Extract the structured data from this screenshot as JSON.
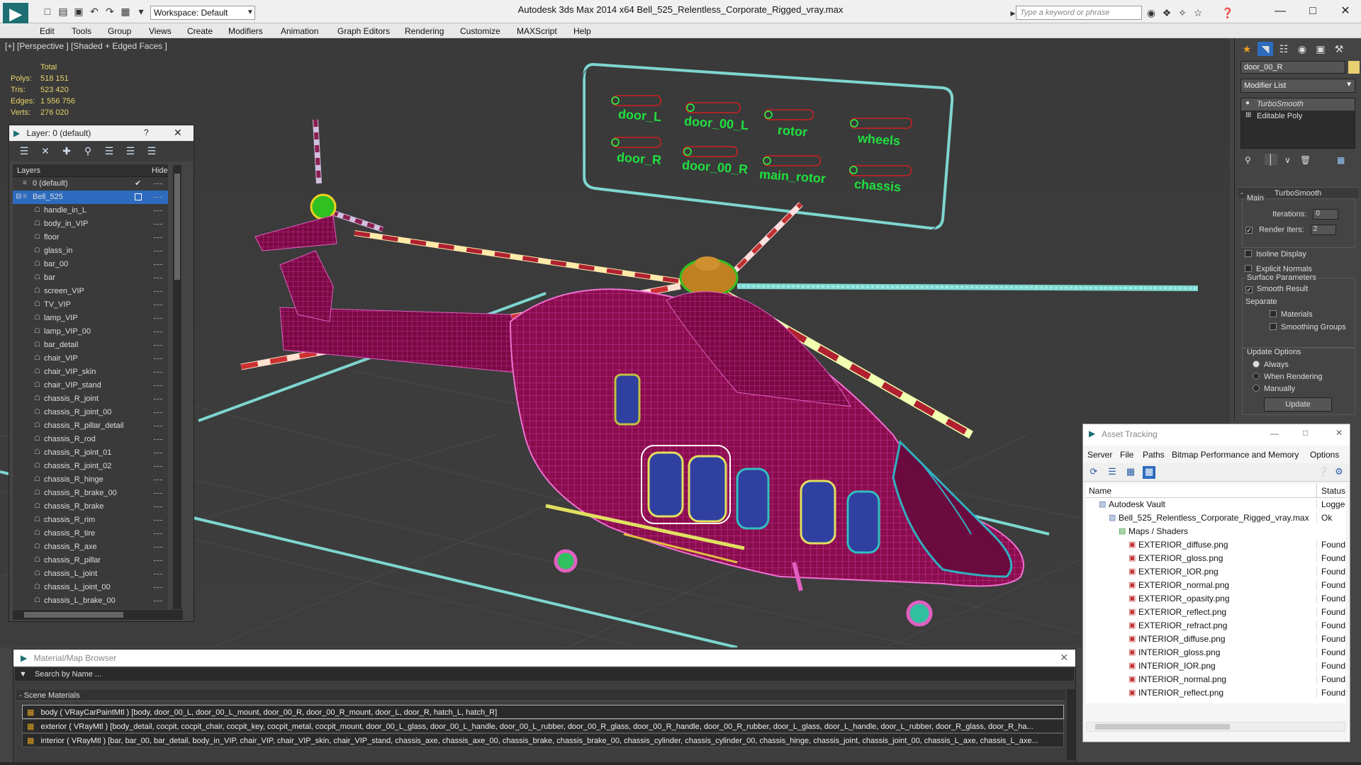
{
  "app": {
    "title": "Autodesk 3ds Max  2014 x64     Bell_525_Relentless_Corporate_Rigged_vray.max",
    "workspace": "Workspace: Default",
    "search_placeholder": "Type a keyword or phrase"
  },
  "menu": [
    "Edit",
    "Tools",
    "Group",
    "Views",
    "Create",
    "Modifiers",
    "Animation",
    "Graph Editors",
    "Rendering",
    "Customize",
    "MAXScript",
    "Help"
  ],
  "viewport": {
    "label": "[+] [Perspective ] [Shaded + Edged Faces ]",
    "stats_header": "Total",
    "stats": [
      {
        "k": "Polys:",
        "v": "518 151"
      },
      {
        "k": "Tris:",
        "v": "523 420"
      },
      {
        "k": "Edges:",
        "v": "1 556 756"
      },
      {
        "k": "Verts:",
        "v": "276 020"
      }
    ],
    "rig_labels": [
      "door_L",
      "door_00_L",
      "rotor",
      "wheels",
      "door_R",
      "door_00_R",
      "main_rotor",
      "chassis"
    ]
  },
  "layer_panel": {
    "title": "Layer: 0 (default)",
    "col_layers": "Layers",
    "col_hide": "Hide",
    "rows": [
      "0 (default)",
      "Bell_525",
      "handle_in_L",
      "body_in_VIP",
      "floor",
      "glass_in",
      "bar_00",
      "bar",
      "screen_VIP",
      "TV_VIP",
      "lamp_VIP",
      "lamp_VIP_00",
      "bar_detail",
      "chair_VIP",
      "chair_VIP_skin",
      "chair_VIP_stand",
      "chassis_R_joint",
      "chassis_R_joint_00",
      "chassis_R_pillar_detail",
      "chassis_R_rod",
      "chassis_R_joint_01",
      "chassis_R_joint_02",
      "chassis_R_hinge",
      "chassis_R_brake_00",
      "chassis_R_brake",
      "chassis_R_rim",
      "chassis_R_tire",
      "chassis_R_axe",
      "chassis_R_pillar",
      "chassis_L_joint",
      "chassis_L_joint_00",
      "chassis_L_brake_00"
    ]
  },
  "command_panel": {
    "object_name": "door_00_R",
    "modifier_list": "Modifier List",
    "stack": [
      "TurboSmooth",
      "Editable Poly"
    ],
    "rollout_title": "TurboSmooth",
    "main": "Main",
    "iterations_label": "Iterations:",
    "iterations_value": "0",
    "render_iters_label": "Render Iters:",
    "render_iters_value": "2",
    "isoline": "Isoline Display",
    "explicit": "Explicit Normals",
    "surface_params": "Surface Parameters",
    "smooth_result": "Smooth Result",
    "separate": "Separate",
    "materials": "Materials",
    "smoothing_groups": "Smoothing Groups",
    "update_options": "Update Options",
    "always": "Always",
    "when_rendering": "When Rendering",
    "manually": "Manually",
    "update_button": "Update"
  },
  "asset_tracking": {
    "title": "Asset Tracking",
    "menu": [
      "Server",
      "File",
      "Paths",
      "Bitmap Performance and Memory",
      "Options"
    ],
    "col_name": "Name",
    "col_status": "Status",
    "rows": [
      {
        "name": "Autodesk Vault",
        "status": "Logged O",
        "indent": 1
      },
      {
        "name": "Bell_525_Relentless_Corporate_Rigged_vray.max",
        "status": "Ok",
        "indent": 2
      },
      {
        "name": "Maps / Shaders",
        "status": "",
        "indent": 3
      },
      {
        "name": "EXTERIOR_diffuse.png",
        "status": "Found",
        "indent": 4
      },
      {
        "name": "EXTERIOR_gloss.png",
        "status": "Found",
        "indent": 4
      },
      {
        "name": "EXTERIOR_IOR.png",
        "status": "Found",
        "indent": 4
      },
      {
        "name": "EXTERIOR_normal.png",
        "status": "Found",
        "indent": 4
      },
      {
        "name": "EXTERIOR_opasity.png",
        "status": "Found",
        "indent": 4
      },
      {
        "name": "EXTERIOR_reflect.png",
        "status": "Found",
        "indent": 4
      },
      {
        "name": "EXTERIOR_refract.png",
        "status": "Found",
        "indent": 4
      },
      {
        "name": "INTERIOR_diffuse.png",
        "status": "Found",
        "indent": 4
      },
      {
        "name": "INTERIOR_gloss.png",
        "status": "Found",
        "indent": 4
      },
      {
        "name": "INTERIOR_IOR.png",
        "status": "Found",
        "indent": 4
      },
      {
        "name": "INTERIOR_normal.png",
        "status": "Found",
        "indent": 4
      },
      {
        "name": "INTERIOR_reflect.png",
        "status": "Found",
        "indent": 4
      }
    ]
  },
  "material_browser": {
    "title": "Material/Map Browser",
    "search_placeholder": "Search by Name ...",
    "group": "- Scene Materials",
    "rows": [
      "body ( VRayCarPaintMtl ) [body, door_00_L, door_00_L_mount, door_00_R, door_00_R_mount, door_L, door_R, hatch_L, hatch_R]",
      "exterior ( VRayMtl ) [body_detail, cocpit, cocpit_chair, cocpit_key, cocpit_metal, cocpit_mount, door_00_L_glass, door_00_L_handle, door_00_L_rubber, door_00_R_glass, door_00_R_handle, door_00_R_rubber, door_L_glass, door_L_handle, door_L_rubber, door_R_glass, door_R_ha...",
      "interior ( VRayMtl ) [bar, bar_00, bar_detail, body_in_VIP, chair_VIP, chair_VIP_skin, chair_VIP_stand, chassis_axe, chassis_axe_00, chassis_brake, chassis_brake_00, chassis_cylinder, chassis_cylinder_00, chassis_hinge, chassis_joint, chassis_joint_00, chassis_L_axe, chassis_L_axe..."
    ]
  }
}
